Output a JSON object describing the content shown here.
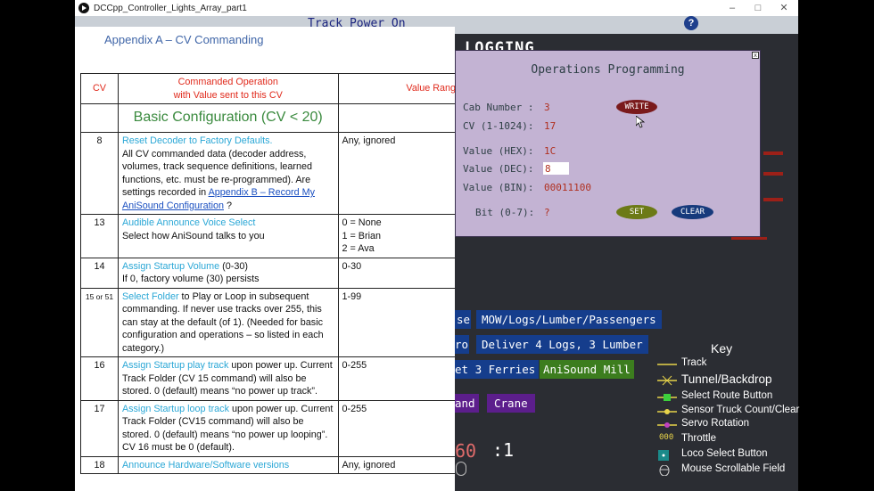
{
  "window": {
    "title": "DCCpp_Controller_Lights_Array_part1",
    "minimize": "–",
    "maximize": "□",
    "close": "✕"
  },
  "header": {
    "track_power": "Track Power On",
    "help": "?"
  },
  "document": {
    "heading": "Appendix A – CV Commanding",
    "columns": {
      "cv": "CV",
      "op_line1": "Commanded Operation",
      "op_line2": "with Value sent to this CV",
      "range": "Value Range"
    },
    "section_title": "Basic Configuration (CV < 20)",
    "rows": [
      {
        "cv": "8",
        "title": "Reset Decoder to Factory Defaults.",
        "body": "All CV commanded data (decoder address, volumes, track sequence definitions, learned functions, etc. must be re-programmed).  Are settings recorded in ",
        "link": "Appendix B – Record My AniSound Configuration",
        "tail": " ?",
        "range": "Any, ignored"
      },
      {
        "cv": "13",
        "title": "Audible Announce Voice Select",
        "body": "Select how AniSound talks to you",
        "range_lines": [
          "0 = None",
          "1 = Brian",
          "2 = Ava"
        ]
      },
      {
        "cv": "14",
        "title": "Assign Startup Volume",
        "title_tail": " (0-30)",
        "body": "If 0, factory volume (30) persists",
        "range": "0-30"
      },
      {
        "cv": "15 or 51",
        "title": "Select Folder",
        "title_tail": " to Play or Loop in subsequent commanding.  If never use tracks over 255, this can stay at the default (of 1).  (Needed for basic configuration and operations – so listed in each category.)",
        "range": "1-99"
      },
      {
        "cv": "16",
        "title": "Assign Startup play track",
        "title_tail": " upon power up.  Current Track Folder (CV 15 command) will also be stored.  0 (default) means “no power up track”.",
        "range": "0-255"
      },
      {
        "cv": "17",
        "title": "Assign Startup loop track",
        "title_tail": " upon power up.  Current Track Folder (CV15 command) will also be stored.  0 (default) means “no power up looping”.  CV 16 must be 0 (default).",
        "range": "0-255"
      },
      {
        "cv": "18",
        "title": "Announce Hardware/Software versions",
        "range": "Any, ignored"
      }
    ]
  },
  "ops": {
    "title": "Operations Programming",
    "cab_label": "Cab Number :",
    "cab_value": "3",
    "cv_label": "CV (1-1024):",
    "cv_value": "17",
    "hex_label": "Value (HEX):",
    "hex_value": "1C",
    "dec_label": "Value (DEC):",
    "dec_value": "8",
    "bin_label": "Value (BIN):",
    "bin_value": "00011100",
    "bit_label": "Bit (0-7):",
    "bit_value": "?",
    "write": "WRITE",
    "set": "SET",
    "clear": "CLEAR",
    "close": "x"
  },
  "background": {
    "logging": "LOGGING",
    "route_buttons": {
      "mow_left": "se",
      "mow": "MOW/Logs/Lumber/Passengers",
      "deliver_left": "ro",
      "deliver": "Deliver 4 Logs, 3 Lumber",
      "ferries": "et 3 Ferries",
      "mill": "AniSound Mill",
      "and": "and",
      "crane": "Crane"
    },
    "loco_number": "60",
    "loco_ratio": ":1"
  },
  "key": {
    "title": "Key",
    "items": [
      {
        "label": "Track"
      },
      {
        "label": "Tunnel/Backdrop"
      },
      {
        "label": "Select Route Button"
      },
      {
        "label": "Sensor Truck Count/Clear"
      },
      {
        "label": "Servo Rotation"
      },
      {
        "label": "Throttle",
        "symbol": "000"
      },
      {
        "label": "Loco Select Button"
      },
      {
        "label": "Mouse Scrollable Field"
      }
    ]
  },
  "colors": {
    "ops_panel": "#c3b3d3",
    "route_blue": "#153d8c",
    "route_green": "#3c7d1e",
    "route_purple": "#5c1e8c",
    "track_yellow": "#e8d44a"
  }
}
